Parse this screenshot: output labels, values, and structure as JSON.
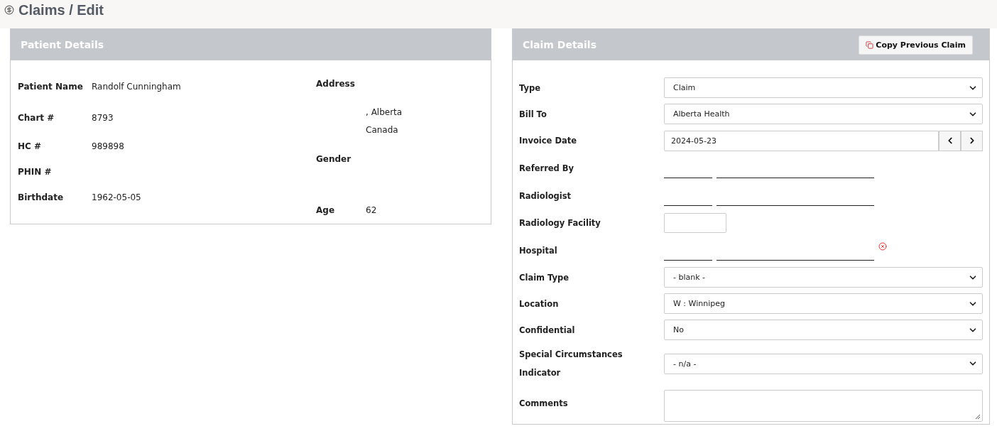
{
  "page": {
    "title": "Claims / Edit"
  },
  "patient": {
    "title": "Patient Details",
    "left": [
      {
        "label": "Patient Name",
        "value": "Randolf Cunningham"
      },
      {
        "label": "Chart #",
        "value": "8793"
      },
      {
        "label": "HC #",
        "value": "989898"
      },
      {
        "label": "PHIN #"
      },
      {
        "label": "Birthdate",
        "value": "1962-05-05"
      }
    ],
    "right": [
      {
        "label": "Address",
        "lines": [
          ", Alberta",
          "Canada"
        ]
      },
      {
        "label": "Gender"
      },
      {
        "label": "Age",
        "value": "62"
      }
    ]
  },
  "claim": {
    "title": "Claim Details",
    "copy_button": "Copy Previous Claim",
    "rows": [
      {
        "kind": "select",
        "label": "Type",
        "value": "Claim"
      },
      {
        "kind": "select",
        "label": "Bill To",
        "value": "Alberta Health"
      },
      {
        "kind": "date",
        "label": "Invoice Date",
        "value": "2024-05-23"
      },
      {
        "kind": "lookup",
        "label": "Referred By",
        "clearable": false
      },
      {
        "kind": "lookup",
        "label": "Radiologist",
        "clearable": false
      },
      {
        "kind": "text",
        "label": "Radiology Facility"
      },
      {
        "kind": "lookup",
        "label": "Hospital",
        "clearable": true
      },
      {
        "kind": "select",
        "label": "Claim Type",
        "value": "- blank -"
      },
      {
        "kind": "select",
        "label": "Location",
        "value": "W : Winnipeg"
      },
      {
        "kind": "select",
        "label": "Confidential",
        "value": "No"
      },
      {
        "kind": "select",
        "label": "Special Circumstances Indicator",
        "value": "- n/a -"
      },
      {
        "kind": "textarea",
        "label": "Comments"
      }
    ]
  }
}
